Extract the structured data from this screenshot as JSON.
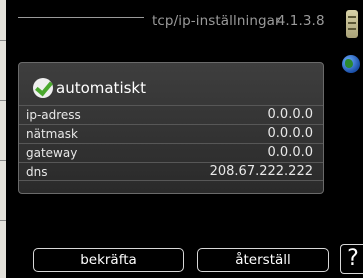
{
  "header": {
    "title": "tcp/ip-inställningar",
    "menu_number": "4.1.3.8"
  },
  "icons": {
    "side_top": "thermometer-icon",
    "side_middle": "globe-icon",
    "checkbox": "checkmark-icon",
    "help": "question-icon"
  },
  "settings": {
    "automatic_label": "automatiskt",
    "automatic_checked": true,
    "fields": [
      {
        "label": "ip-adress",
        "value": "0.0.0.0"
      },
      {
        "label": "nätmask",
        "value": "0.0.0.0"
      },
      {
        "label": "gateway",
        "value": "0.0.0.0"
      },
      {
        "label": "dns",
        "value": "208.67.222.222"
      }
    ]
  },
  "buttons": {
    "confirm_label": "bekräfta",
    "reset_label": "återställ",
    "help_label": "?"
  },
  "colors": {
    "background": "#000000",
    "panel": "#333333",
    "header_text": "#9a9a9a",
    "check_green": "#4aa82e"
  }
}
